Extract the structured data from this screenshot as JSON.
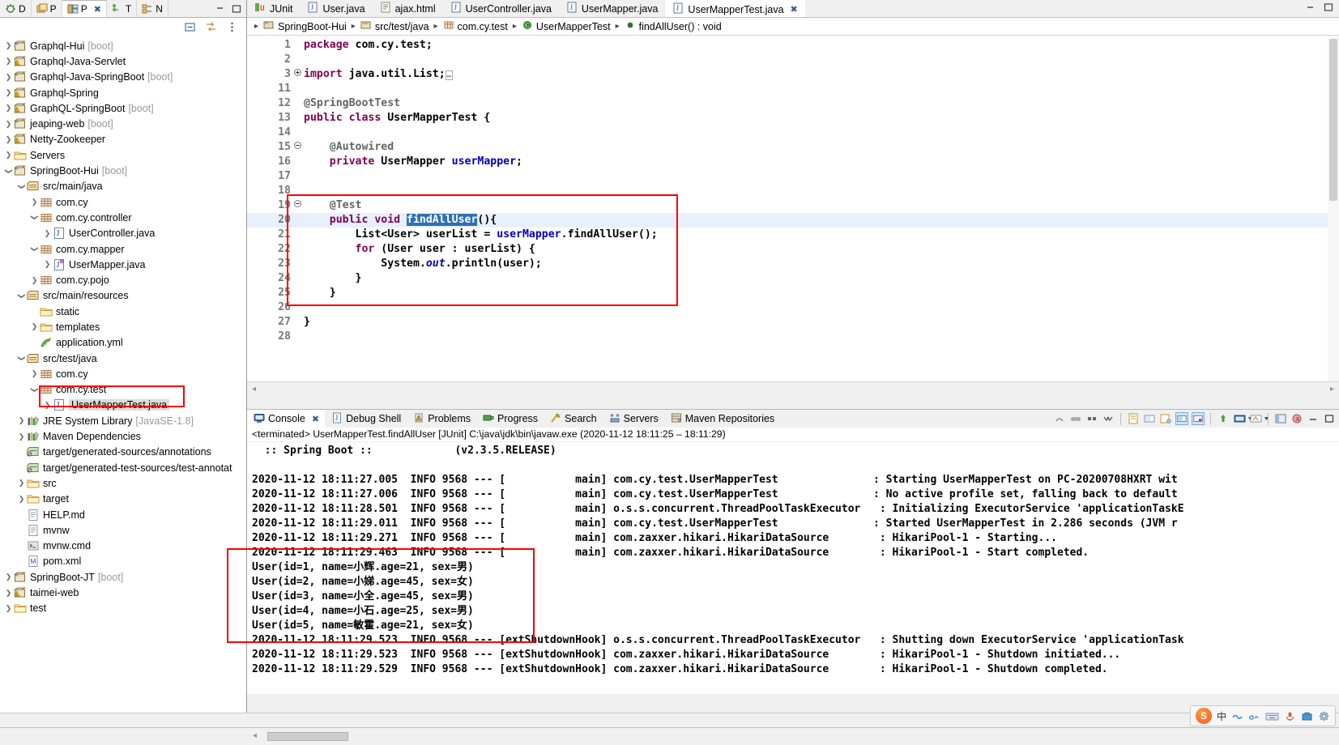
{
  "left_panel": {
    "tabs": [
      {
        "label": "D",
        "icon": "debug-icon",
        "active": false
      },
      {
        "label": "P",
        "icon": "package-explorer-icon",
        "active": false
      },
      {
        "label": "P",
        "icon": "project-explorer-icon",
        "active": true
      },
      {
        "label": "T",
        "icon": "type-hierarchy-icon",
        "active": false
      },
      {
        "label": "N",
        "icon": "navigator-icon",
        "active": false
      }
    ],
    "window_buttons": [
      "minimize-icon",
      "maximize-icon"
    ],
    "toolbar": [
      "collapse-all-icon",
      "link-with-editor-icon",
      "view-menu-icon"
    ],
    "tree": [
      {
        "indent": 0,
        "arrow": "collapsed",
        "icon": "maven-project-icon",
        "label": "Graphql-Hui",
        "suffix": "[boot]"
      },
      {
        "indent": 0,
        "arrow": "collapsed",
        "icon": "maven-project-warn-icon",
        "label": "Graphql-Java-Servlet",
        "suffix": ""
      },
      {
        "indent": 0,
        "arrow": "collapsed",
        "icon": "maven-project-icon",
        "label": "Graphql-Java-SpringBoot",
        "suffix": "[boot]"
      },
      {
        "indent": 0,
        "arrow": "collapsed",
        "icon": "maven-project-warn-icon",
        "label": "Graphql-Spring",
        "suffix": ""
      },
      {
        "indent": 0,
        "arrow": "collapsed",
        "icon": "maven-project-warn-icon",
        "label": "GraphQL-SpringBoot",
        "suffix": "[boot]"
      },
      {
        "indent": 0,
        "arrow": "collapsed",
        "icon": "maven-project-icon",
        "label": "jeaping-web",
        "suffix": "[boot]"
      },
      {
        "indent": 0,
        "arrow": "collapsed",
        "icon": "maven-project-warn-icon",
        "label": "Netty-Zookeeper",
        "suffix": ""
      },
      {
        "indent": 0,
        "arrow": "collapsed",
        "icon": "folder-icon",
        "label": "Servers",
        "suffix": ""
      },
      {
        "indent": 0,
        "arrow": "expanded",
        "icon": "maven-project-icon",
        "label": "SpringBoot-Hui",
        "suffix": "[boot]"
      },
      {
        "indent": 1,
        "arrow": "expanded",
        "icon": "source-folder-icon",
        "label": "src/main/java",
        "suffix": ""
      },
      {
        "indent": 2,
        "arrow": "collapsed",
        "icon": "package-icon",
        "label": "com.cy",
        "suffix": ""
      },
      {
        "indent": 2,
        "arrow": "expanded",
        "icon": "package-icon",
        "label": "com.cy.controller",
        "suffix": ""
      },
      {
        "indent": 3,
        "arrow": "collapsed",
        "icon": "java-class-icon",
        "label": "UserController.java",
        "suffix": ""
      },
      {
        "indent": 2,
        "arrow": "expanded",
        "icon": "package-icon",
        "label": "com.cy.mapper",
        "suffix": ""
      },
      {
        "indent": 3,
        "arrow": "collapsed",
        "icon": "java-interface-icon",
        "label": "UserMapper.java",
        "suffix": ""
      },
      {
        "indent": 2,
        "arrow": "collapsed",
        "icon": "package-icon",
        "label": "com.cy.pojo",
        "suffix": ""
      },
      {
        "indent": 1,
        "arrow": "expanded",
        "icon": "source-folder-icon",
        "label": "src/main/resources",
        "suffix": ""
      },
      {
        "indent": 2,
        "arrow": "none",
        "icon": "folder-icon",
        "label": "static",
        "suffix": ""
      },
      {
        "indent": 2,
        "arrow": "collapsed",
        "icon": "folder-icon",
        "label": "templates",
        "suffix": ""
      },
      {
        "indent": 2,
        "arrow": "none",
        "icon": "yml-file-icon",
        "label": "application.yml",
        "suffix": ""
      },
      {
        "indent": 1,
        "arrow": "expanded",
        "icon": "source-folder-icon",
        "label": "src/test/java",
        "suffix": ""
      },
      {
        "indent": 2,
        "arrow": "collapsed",
        "icon": "package-icon",
        "label": "com.cy",
        "suffix": ""
      },
      {
        "indent": 2,
        "arrow": "expanded",
        "icon": "package-icon",
        "label": "com.cy.test",
        "suffix": ""
      },
      {
        "indent": 3,
        "arrow": "collapsed",
        "icon": "java-class-icon",
        "label": "UserMapperTest.java",
        "suffix": "",
        "selected": true
      },
      {
        "indent": 1,
        "arrow": "collapsed",
        "icon": "library-icon",
        "label": "JRE System Library",
        "suffix": "[JavaSE-1.8]"
      },
      {
        "indent": 1,
        "arrow": "collapsed",
        "icon": "library-icon",
        "label": "Maven Dependencies",
        "suffix": ""
      },
      {
        "indent": 1,
        "arrow": "none",
        "icon": "generated-source-icon",
        "label": "target/generated-sources/annotations",
        "suffix": ""
      },
      {
        "indent": 1,
        "arrow": "none",
        "icon": "generated-source-icon",
        "label": "target/generated-test-sources/test-annotat",
        "suffix": ""
      },
      {
        "indent": 1,
        "arrow": "collapsed",
        "icon": "folder-icon",
        "label": "src",
        "suffix": ""
      },
      {
        "indent": 1,
        "arrow": "collapsed",
        "icon": "folder-icon",
        "label": "target",
        "suffix": ""
      },
      {
        "indent": 1,
        "arrow": "none",
        "icon": "file-icon",
        "label": "HELP.md",
        "suffix": ""
      },
      {
        "indent": 1,
        "arrow": "none",
        "icon": "file-icon",
        "label": "mvnw",
        "suffix": ""
      },
      {
        "indent": 1,
        "arrow": "none",
        "icon": "cmd-file-icon",
        "label": "mvnw.cmd",
        "suffix": ""
      },
      {
        "indent": 1,
        "arrow": "none",
        "icon": "xml-file-icon",
        "label": "pom.xml",
        "suffix": ""
      },
      {
        "indent": 0,
        "arrow": "collapsed",
        "icon": "maven-project-icon",
        "label": "SpringBoot-JT",
        "suffix": "[boot]"
      },
      {
        "indent": 0,
        "arrow": "collapsed",
        "icon": "maven-project-warn-icon",
        "label": "taimei-web",
        "suffix": ""
      },
      {
        "indent": 0,
        "arrow": "collapsed",
        "icon": "folder-icon",
        "label": "test",
        "suffix": ""
      }
    ]
  },
  "editor": {
    "tabs": [
      {
        "label": "JUnit",
        "icon": "junit-icon",
        "active": false,
        "closable": false
      },
      {
        "label": "User.java",
        "icon": "java-class-icon",
        "active": false,
        "closable": false
      },
      {
        "label": "ajax.html",
        "icon": "html-file-icon",
        "active": false,
        "closable": false
      },
      {
        "label": "UserController.java",
        "icon": "java-class-icon",
        "active": false,
        "closable": false
      },
      {
        "label": "UserMapper.java",
        "icon": "java-class-icon",
        "active": false,
        "closable": false
      },
      {
        "label": "UserMapperTest.java",
        "icon": "java-class-icon",
        "active": true,
        "closable": true
      }
    ],
    "window_buttons": [
      "minimize-icon",
      "maximize-icon"
    ],
    "breadcrumb": [
      {
        "icon": "maven-project-icon",
        "label": "SpringBoot-Hui"
      },
      {
        "icon": "source-folder-icon",
        "label": "src/test/java"
      },
      {
        "icon": "package-icon",
        "label": "com.cy.test"
      },
      {
        "icon": "class-icon",
        "label": "UserMapperTest"
      },
      {
        "icon": "method-icon",
        "label": "findAllUser() : void"
      }
    ],
    "lines": [
      {
        "num": "1",
        "fold": "",
        "highlight": false,
        "changed": false,
        "tokens": [
          {
            "t": "package ",
            "c": "kw"
          },
          {
            "t": "com.cy.test;",
            "c": "plain"
          }
        ]
      },
      {
        "num": "2",
        "fold": "",
        "highlight": false,
        "changed": false,
        "tokens": []
      },
      {
        "num": "3",
        "fold": "+",
        "highlight": false,
        "changed": false,
        "tokens": [
          {
            "t": "import ",
            "c": "kw"
          },
          {
            "t": "java.util.List;",
            "c": "plain"
          },
          {
            "t": "…",
            "c": "foldbox"
          }
        ]
      },
      {
        "num": "11",
        "fold": "",
        "highlight": false,
        "changed": false,
        "tokens": []
      },
      {
        "num": "12",
        "fold": "",
        "highlight": false,
        "changed": false,
        "tokens": [
          {
            "t": "@SpringBootTest",
            "c": "ann"
          }
        ]
      },
      {
        "num": "13",
        "fold": "",
        "highlight": false,
        "changed": false,
        "tokens": [
          {
            "t": "public class ",
            "c": "kw"
          },
          {
            "t": "UserMapperTest {",
            "c": "plain"
          }
        ]
      },
      {
        "num": "14",
        "fold": "",
        "highlight": false,
        "changed": false,
        "tokens": []
      },
      {
        "num": "15",
        "fold": "-",
        "highlight": false,
        "changed": false,
        "tokens": [
          {
            "t": "    @Autowired",
            "c": "ann"
          }
        ]
      },
      {
        "num": "16",
        "fold": "",
        "highlight": false,
        "changed": false,
        "tokens": [
          {
            "t": "    ",
            "c": "plain"
          },
          {
            "t": "private ",
            "c": "kw"
          },
          {
            "t": "UserMapper ",
            "c": "plain"
          },
          {
            "t": "userMapper",
            "c": "fld"
          },
          {
            "t": ";",
            "c": "plain"
          }
        ]
      },
      {
        "num": "17",
        "fold": "",
        "highlight": false,
        "changed": false,
        "tokens": []
      },
      {
        "num": "18",
        "fold": "",
        "highlight": false,
        "changed": false,
        "tokens": []
      },
      {
        "num": "19",
        "fold": "-",
        "highlight": false,
        "changed": true,
        "tokens": [
          {
            "t": "    @Test",
            "c": "ann"
          }
        ]
      },
      {
        "num": "20",
        "fold": "",
        "highlight": true,
        "changed": true,
        "tokens": [
          {
            "t": "    ",
            "c": "plain"
          },
          {
            "t": "public void ",
            "c": "kw"
          },
          {
            "t": "findAllUser",
            "c": "sel"
          },
          {
            "t": "(){",
            "c": "plain"
          }
        ]
      },
      {
        "num": "21",
        "fold": "",
        "highlight": false,
        "changed": true,
        "tokens": [
          {
            "t": "        List<User> ",
            "c": "plain"
          },
          {
            "t": "userList",
            "c": "plain"
          },
          {
            "t": " = ",
            "c": "plain"
          },
          {
            "t": "userMapper",
            "c": "fld"
          },
          {
            "t": ".findAllUser();",
            "c": "plain"
          }
        ]
      },
      {
        "num": "22",
        "fold": "",
        "highlight": false,
        "changed": true,
        "tokens": [
          {
            "t": "        ",
            "c": "plain"
          },
          {
            "t": "for ",
            "c": "kw"
          },
          {
            "t": "(User user : userList) {",
            "c": "plain"
          }
        ]
      },
      {
        "num": "23",
        "fold": "",
        "highlight": false,
        "changed": true,
        "tokens": [
          {
            "t": "            System.",
            "c": "plain"
          },
          {
            "t": "out",
            "c": "sfld"
          },
          {
            "t": ".println(user);",
            "c": "plain"
          }
        ]
      },
      {
        "num": "24",
        "fold": "",
        "highlight": false,
        "changed": true,
        "tokens": [
          {
            "t": "        }",
            "c": "plain"
          }
        ]
      },
      {
        "num": "25",
        "fold": "",
        "highlight": false,
        "changed": true,
        "tokens": [
          {
            "t": "    }",
            "c": "plain"
          }
        ]
      },
      {
        "num": "26",
        "fold": "",
        "highlight": false,
        "changed": false,
        "tokens": []
      },
      {
        "num": "27",
        "fold": "",
        "highlight": false,
        "changed": false,
        "tokens": [
          {
            "t": "}",
            "c": "plain"
          }
        ]
      },
      {
        "num": "28",
        "fold": "",
        "highlight": false,
        "changed": false,
        "tokens": []
      }
    ]
  },
  "console": {
    "tabs": [
      {
        "label": "Console",
        "icon": "console-icon",
        "active": true,
        "closable": true
      },
      {
        "label": "Debug Shell",
        "icon": "debug-shell-icon",
        "active": false,
        "closable": false
      },
      {
        "label": "Problems",
        "icon": "problems-icon",
        "active": false,
        "closable": false
      },
      {
        "label": "Progress",
        "icon": "progress-icon",
        "active": false,
        "closable": false
      },
      {
        "label": "Search",
        "icon": "search-icon",
        "active": false,
        "closable": false
      },
      {
        "label": "Servers",
        "icon": "servers-icon",
        "active": false,
        "closable": false
      },
      {
        "label": "Maven Repositories",
        "icon": "maven-repo-icon",
        "active": false,
        "closable": false
      }
    ],
    "toolbar_icons": [
      "terminate-all-icon",
      "remove-launch-icon",
      "terminate-icon",
      "remove-all-terminated-icon",
      "word-wrap-icon",
      "show-console-icon",
      "pin-console-icon",
      "display-selected-console-icon",
      "open-console-icon",
      "scroll-lock-icon",
      "view-menu-icon",
      "minimize-icon",
      "maximize-icon"
    ],
    "status_line": "<terminated> UserMapperTest.findAllUser [JUnit] C:\\java\\jdk\\bin\\javaw.exe  (2020-11-12 18:11:25 – 18:11:29)",
    "output": [
      "  :: Spring Boot ::             (v2.3.5.RELEASE)",
      "",
      "2020-11-12 18:11:27.005  INFO 9568 --- [           main] com.cy.test.UserMapperTest               : Starting UserMapperTest on PC-20200708HXRT wit",
      "2020-11-12 18:11:27.006  INFO 9568 --- [           main] com.cy.test.UserMapperTest               : No active profile set, falling back to default",
      "2020-11-12 18:11:28.501  INFO 9568 --- [           main] o.s.s.concurrent.ThreadPoolTaskExecutor   : Initializing ExecutorService 'applicationTaskE",
      "2020-11-12 18:11:29.011  INFO 9568 --- [           main] com.cy.test.UserMapperTest               : Started UserMapperTest in 2.286 seconds (JVM r",
      "2020-11-12 18:11:29.271  INFO 9568 --- [           main] com.zaxxer.hikari.HikariDataSource        : HikariPool-1 - Starting...",
      "2020-11-12 18:11:29.463  INFO 9568 --- [           main] com.zaxxer.hikari.HikariDataSource        : HikariPool-1 - Start completed.",
      "User(id=1, name=小辉.age=21, sex=男)",
      "User(id=2, name=小娣.age=45, sex=女)",
      "User(id=3, name=小全.age=45, sex=男)",
      "User(id=4, name=小石.age=25, sex=男)",
      "User(id=5, name=敏霍.age=21, sex=女)",
      "2020-11-12 18:11:29.523  INFO 9568 --- [extShutdownHook] o.s.s.concurrent.ThreadPoolTaskExecutor   : Shutting down ExecutorService 'applicationTask",
      "2020-11-12 18:11:29.523  INFO 9568 --- [extShutdownHook] com.zaxxer.hikari.HikariDataSource        : HikariPool-1 - Shutdown initiated...",
      "2020-11-12 18:11:29.529  INFO 9568 --- [extShutdownHook] com.zaxxer.hikari.HikariDataSource        : HikariPool-1 - Shutdown completed."
    ]
  },
  "ime_bar": {
    "logo": "S",
    "items": [
      "中",
      "chinese-pinyin-icon",
      "half-width-icon",
      "keyboard-icon",
      "voice-icon",
      "toolbox-icon",
      "settings-icon"
    ]
  },
  "colors": {
    "accent_red": "#ff0000",
    "keyword": "#7f0055",
    "field": "#0000c0",
    "annotation": "#646464",
    "selection": "#2f6fb5",
    "line_highlight": "#e8f0fb"
  }
}
